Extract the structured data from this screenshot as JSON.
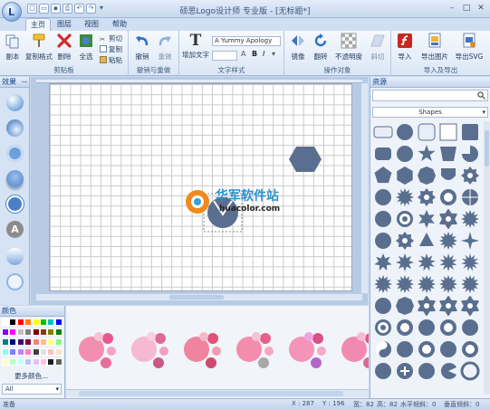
{
  "title": "硕思Logo设计师 专业版 - [无标题*]",
  "tabs": [
    "主页",
    "图层",
    "视图",
    "帮助"
  ],
  "ribbon": {
    "clipboard": {
      "label": "剪贴板",
      "paste": "副本",
      "format_painter": "复制格式",
      "delete": "删除",
      "select_all": "全选",
      "cut": "剪切",
      "copy": "复制",
      "paste_small": "粘贴"
    },
    "undo": {
      "label": "撤销与重做",
      "undo": "撤销",
      "redo": "重做"
    },
    "text": {
      "label": "文字样式",
      "add_text": "增加文字",
      "font": "A Yummy Apology",
      "bold": "B",
      "italic": "I"
    },
    "ops": {
      "label": "操作对象",
      "mirror": "镜像",
      "flip": "翻转",
      "opacity": "不透明度",
      "skew": "斜切"
    },
    "io": {
      "label": "导入及导出",
      "import": "导入",
      "export_img": "导出图片",
      "export_svg": "导出SVG"
    }
  },
  "panels": {
    "effects": "效果",
    "assets": "资源",
    "assets_select": "Shapes",
    "colors": "颜色",
    "more_colors": "更多颜色...",
    "all": "All"
  },
  "colors": {
    "accent": "#5a6f8f",
    "hexagon": "#5a6f8f",
    "swatches": [
      "#ffffff",
      "#000000",
      "#ff0000",
      "#ff8000",
      "#ffff00",
      "#00c000",
      "#00c0c0",
      "#0000ff",
      "#8000ff",
      "#ff00ff",
      "#c0c0c0",
      "#808080",
      "#800000",
      "#804000",
      "#808000",
      "#008000",
      "#008080",
      "#000080",
      "#400080",
      "#800040",
      "#ff8080",
      "#ffc080",
      "#ffff80",
      "#80ff80",
      "#80ffff",
      "#8080ff",
      "#c080ff",
      "#ff80c0",
      "#404040",
      "#e0e0e0",
      "#ffc0c0",
      "#ffe0c0",
      "#ffffc0",
      "#c0ffc0",
      "#c0ffff",
      "#c0c0ff",
      "#e0c0ff",
      "#ffc0e0",
      "#202020",
      "#606060"
    ]
  },
  "presets": [
    {
      "main": "#f28fb0",
      "dot1": "#e8578d",
      "dot2": "#f4a4c1",
      "dot3": "#e86f9b",
      "dot4": "#f7c3d5"
    },
    {
      "main": "#f6b9cf",
      "dot1": "#e06a93",
      "dot2": "#f0a1bf",
      "dot3": "#c85a86",
      "dot4": "#f8cfe0"
    },
    {
      "main": "#f0849f",
      "dot1": "#e34f78",
      "dot2": "#f29bb4",
      "dot3": "#cc4a6d",
      "dot4": "#f6b8c9"
    },
    {
      "main": "#f48cae",
      "dot1": "#e85e8a",
      "dot2": "#f8a6c2",
      "dot3": "#a8a8a8",
      "dot4": "#f5c4d4"
    },
    {
      "main": "#f394b8",
      "dot1": "#d94f8a",
      "dot2": "#f4aac8",
      "dot3": "#b565c8",
      "dot4": "#f0a3e0"
    },
    {
      "main": "#f18aae",
      "dot1": "#e2558a",
      "dot2": "#f59fc0",
      "dot3": "#d66b98",
      "dot4": "#f4bcd0"
    }
  ],
  "status": {
    "ready": "准备",
    "x": "X : 287",
    "y": "Y : 196",
    "width": "宽：82",
    "height": "高：82",
    "hskew": "水平倾斜：0",
    "vskew": "垂直倾斜：0"
  },
  "watermark": {
    "name": "华军软件站",
    "url": "huacolor.com"
  }
}
